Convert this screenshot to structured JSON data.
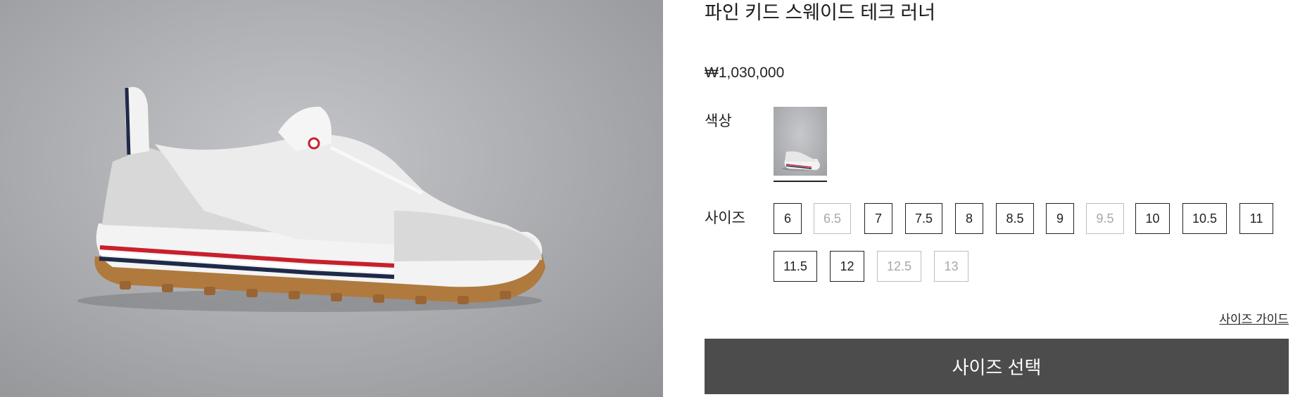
{
  "product": {
    "title": "파인 키드 스웨이드 테크 러너",
    "price": "₩1,030,000"
  },
  "color": {
    "label": "색상"
  },
  "size": {
    "label": "사이즈",
    "options": [
      {
        "value": "6",
        "available": true
      },
      {
        "value": "6.5",
        "available": false
      },
      {
        "value": "7",
        "available": true
      },
      {
        "value": "7.5",
        "available": true
      },
      {
        "value": "8",
        "available": true
      },
      {
        "value": "8.5",
        "available": true
      },
      {
        "value": "9",
        "available": true
      },
      {
        "value": "9.5",
        "available": false
      },
      {
        "value": "10",
        "available": true
      },
      {
        "value": "10.5",
        "available": true
      },
      {
        "value": "11",
        "available": true
      },
      {
        "value": "11.5",
        "available": true
      },
      {
        "value": "12",
        "available": true
      },
      {
        "value": "12.5",
        "available": false
      },
      {
        "value": "13",
        "available": false
      }
    ],
    "guide_label": "사이즈 가이드"
  },
  "cta": {
    "select_size_label": "사이즈 선택",
    "color": "#4c4c4c"
  },
  "image": {
    "subject": "shoe-photo"
  }
}
